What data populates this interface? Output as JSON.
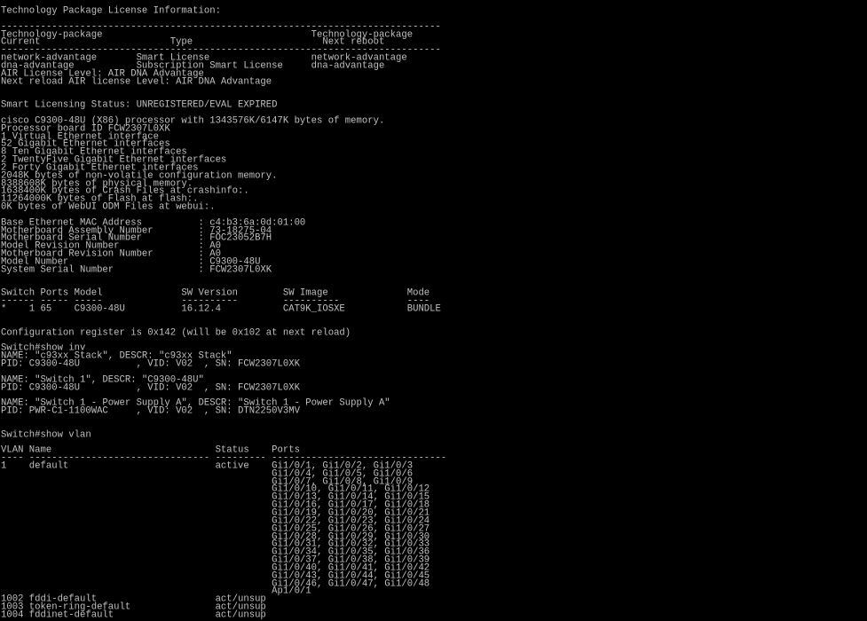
{
  "terminal": {
    "colors": {
      "background": "#000000",
      "text": "#c0c0c0"
    },
    "lines": [
      "Technology Package License Information:",
      "",
      "------------------------------------------------------------------------------",
      "Technology-package                                     Technology-package",
      "Current                       Type                       Next reboot",
      "------------------------------------------------------------------------------",
      "network-advantage       Smart License                  network-advantage",
      "dna-advantage           Subscription Smart License     dna-advantage",
      "AIR License Level: AIR DNA Advantage",
      "Next reload AIR license Level: AIR DNA Advantage",
      "",
      "",
      "Smart Licensing Status: UNREGISTERED/EVAL EXPIRED",
      "",
      "cisco C9300-48U (X86) processor with 1343576K/6147K bytes of memory.",
      "Processor board ID FCW2307L0XK",
      "1 Virtual Ethernet interface",
      "52 Gigabit Ethernet interfaces",
      "8 Ten Gigabit Ethernet interfaces",
      "2 TwentyFive Gigabit Ethernet interfaces",
      "2 Forty Gigabit Ethernet interfaces",
      "2048K bytes of non-volatile configuration memory.",
      "8388608K bytes of physical memory.",
      "1638400K bytes of Crash Files at crashinfo:.",
      "11264000K bytes of Flash at flash:.",
      "0K bytes of WebUI ODM Files at webui:.",
      "",
      "Base Ethernet MAC Address          : c4:b3:6a:0d:01:00",
      "Motherboard Assembly Number        : 73-18275-04",
      "Motherboard Serial Number          : FOC23052B7H",
      "Model Revision Number              : A0",
      "Motherboard Revision Number        : A0",
      "Model Number                       : C9300-48U",
      "System Serial Number               : FCW2307L0XK",
      "",
      "",
      "Switch Ports Model              SW Version        SW Image              Mode",
      "------ ----- -----              ----------        ----------            ----",
      "*    1 65    C9300-48U          16.12.4           CAT9K_IOSXE           BUNDLE",
      "",
      "",
      "Configuration register is 0x142 (will be 0x102 at next reload)",
      "",
      "Switch#show inv",
      "NAME: \"c93xx Stack\", DESCR: \"c93xx Stack\"",
      "PID: C9300-48U          , VID: V02  , SN: FCW2307L0XK",
      "",
      "NAME: \"Switch 1\", DESCR: \"C9300-48U\"",
      "PID: C9300-48U          , VID: V02  , SN: FCW2307L0XK",
      "",
      "NAME: \"Switch 1 - Power Supply A\", DESCR: \"Switch 1 - Power Supply A\"",
      "PID: PWR-C1-1100WAC     , VID: V02  , SN: DTN2250V3MV",
      "",
      "",
      "Switch#show vlan",
      "",
      "VLAN Name                             Status    Ports",
      "---- -------------------------------- --------- -------------------------------",
      "1    default                          active    Gi1/0/1, Gi1/0/2, Gi1/0/3",
      "                                                Gi1/0/4, Gi1/0/5, Gi1/0/6",
      "                                                Gi1/0/7, Gi1/0/8, Gi1/0/9",
      "                                                Gi1/0/10, Gi1/0/11, Gi1/0/12",
      "                                                Gi1/0/13, Gi1/0/14, Gi1/0/15",
      "                                                Gi1/0/16, Gi1/0/17, Gi1/0/18",
      "                                                Gi1/0/19, Gi1/0/20, Gi1/0/21",
      "                                                Gi1/0/22, Gi1/0/23, Gi1/0/24",
      "                                                Gi1/0/25, Gi1/0/26, Gi1/0/27",
      "                                                Gi1/0/28, Gi1/0/29, Gi1/0/30",
      "                                                Gi1/0/31, Gi1/0/32, Gi1/0/33",
      "                                                Gi1/0/34, Gi1/0/35, Gi1/0/36",
      "                                                Gi1/0/37, Gi1/0/38, Gi1/0/39",
      "                                                Gi1/0/40, Gi1/0/41, Gi1/0/42",
      "                                                Gi1/0/43, Gi1/0/44, Gi1/0/45",
      "                                                Gi1/0/46, Gi1/0/47, Gi1/0/48",
      "                                                Ap1/0/1",
      "1002 fddi-default                     act/unsup",
      "1003 token-ring-default               act/unsup",
      "1004 fddinet-default                  act/unsup"
    ]
  }
}
